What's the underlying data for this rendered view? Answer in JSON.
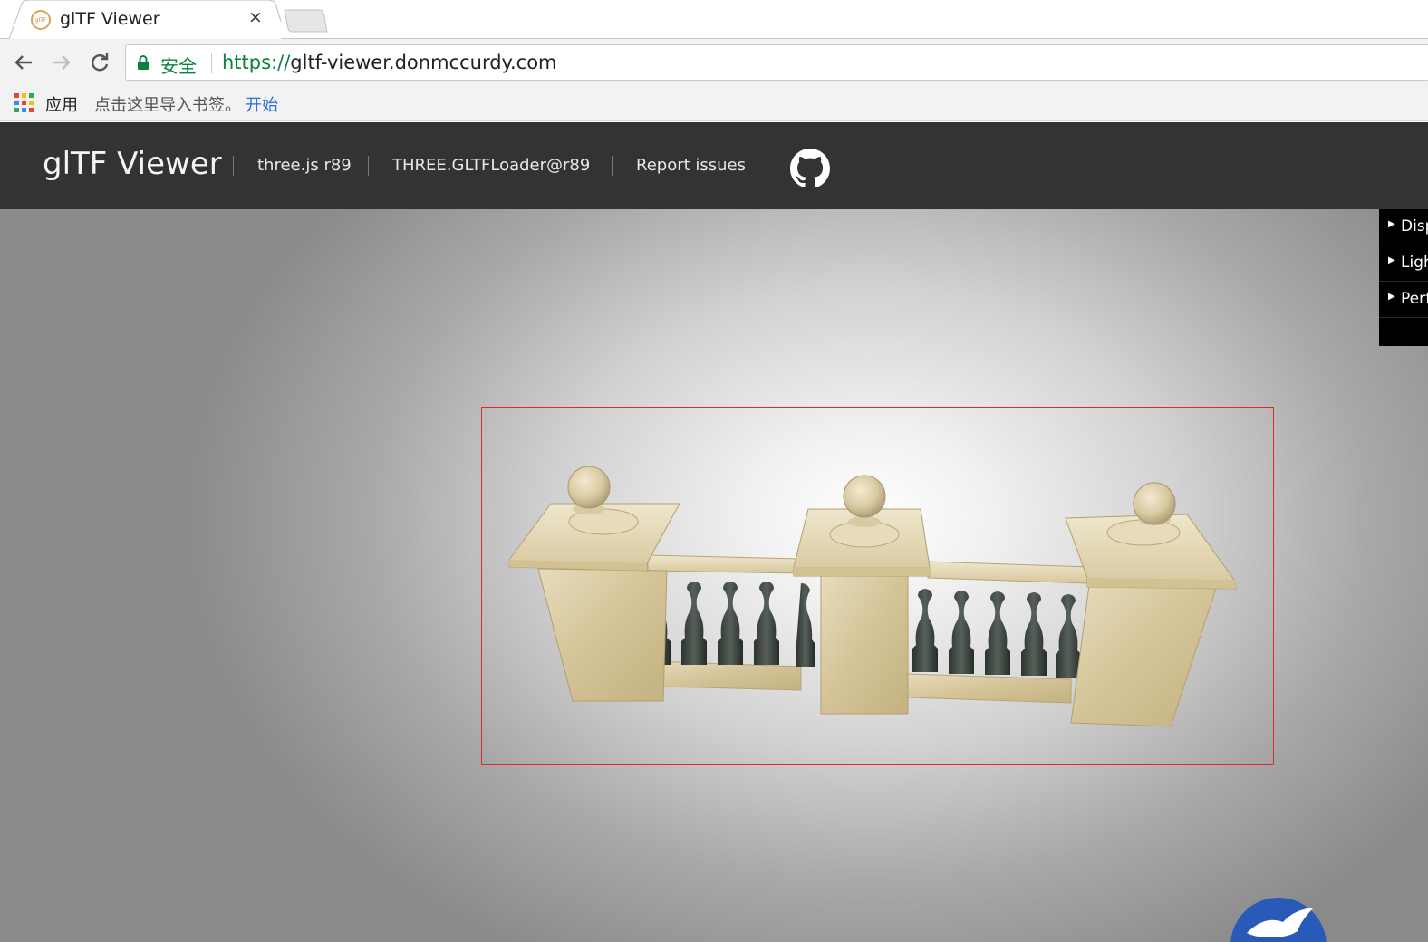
{
  "browser": {
    "tab": {
      "title": "glTF Viewer",
      "favicon_text": "glTF",
      "close_icon": "×"
    },
    "omnibox": {
      "secure_label": "安全",
      "url_scheme": "https://",
      "url_host": "gltf-viewer.donmccurdy.com"
    },
    "bookmarks": {
      "apps_label": "应用",
      "hint": "点击这里导入书签。",
      "start_link": "开始"
    }
  },
  "app": {
    "title": "glTF Viewer",
    "links": [
      {
        "label": "three.js r89"
      },
      {
        "label": "THREE.GLTFLoader@r89"
      },
      {
        "label": "Report issues"
      }
    ]
  },
  "gui": {
    "folders": [
      {
        "label": "Display"
      },
      {
        "label": "Lighting"
      },
      {
        "label": "Performance"
      }
    ]
  },
  "colors": {
    "appbar": "#333333",
    "selection_box": "#e02a2a",
    "secure_green": "#0b8043",
    "link_blue": "#2a6fdb"
  }
}
